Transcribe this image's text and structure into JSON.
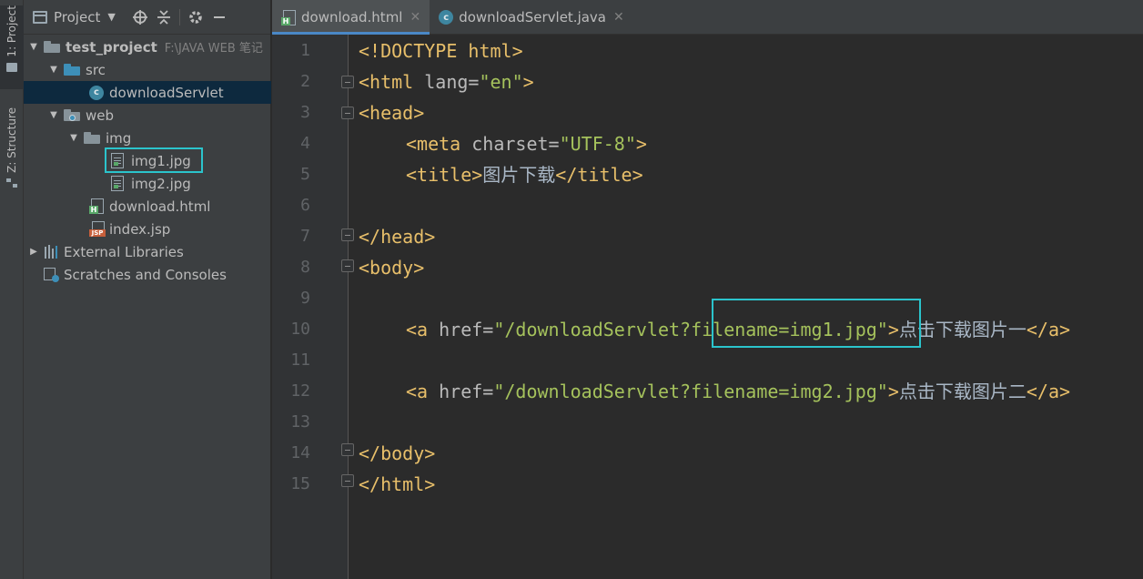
{
  "tool_strip": {
    "project_tab": "1: Project",
    "structure_tab": "Z: Structure"
  },
  "project_panel": {
    "title": "Project",
    "tree": [
      {
        "label": "test_project",
        "hint": "F:\\JAVA WEB 笔记"
      },
      {
        "label": "src"
      },
      {
        "label": "downloadServlet"
      },
      {
        "label": "web"
      },
      {
        "label": "img"
      },
      {
        "label": "img1.jpg"
      },
      {
        "label": "img2.jpg"
      },
      {
        "label": "download.html"
      },
      {
        "label": "index.jsp"
      },
      {
        "label": "External Libraries"
      },
      {
        "label": "Scratches and Consoles"
      }
    ]
  },
  "tabs": [
    {
      "label": "download.html",
      "active": true
    },
    {
      "label": "downloadServlet.java",
      "active": false
    }
  ],
  "editor": {
    "line_numbers": [
      "1",
      "2",
      "3",
      "4",
      "5",
      "6",
      "7",
      "8",
      "9",
      "10",
      "11",
      "12",
      "13",
      "14",
      "15"
    ],
    "code": {
      "l1": "<!DOCTYPE html>",
      "l2_tag_open": "<html",
      "l2_attr": " lang=",
      "l2_val": "\"en\"",
      "l2_close": ">",
      "l3": "<head>",
      "l4_tag_open": "<meta",
      "l4_attr": " charset=",
      "l4_val": "\"UTF-8\"",
      "l4_close": ">",
      "l5_open": "<title>",
      "l5_text": "图片下载",
      "l5_close": "</title>",
      "l7": "</head>",
      "l8": "<body>",
      "l10_tag_open": "<a",
      "l10_attr": " href=",
      "l10_val": "\"/downloadServlet?filename=img1.jpg\"",
      "l10_gt": ">",
      "l10_text": "点击下载图片一",
      "l10_close": "</a>",
      "l12_tag_open": "<a",
      "l12_attr": " href=",
      "l12_val": "\"/downloadServlet?filename=img2.jpg\"",
      "l12_gt": ">",
      "l12_text": "点击下载图片二",
      "l12_close": "</a>",
      "l14": "</body>",
      "l15": "</html>"
    }
  },
  "colors": {
    "tag": "#e8bf6a",
    "string": "#a5c25c",
    "highlight_box": "#2bc4cc",
    "selection": "#0d293e"
  }
}
